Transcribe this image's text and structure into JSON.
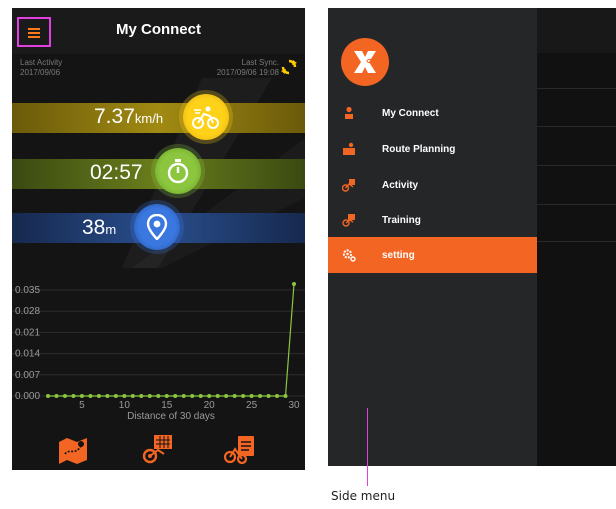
{
  "left_phone": {
    "title": "My Connect",
    "last_activity": {
      "label": "Last Activity",
      "date": "2017/09/06"
    },
    "last_sync": {
      "label": "Last Sync.",
      "datetime": "2017/09/06 19:08"
    },
    "stats": [
      {
        "value": "7.37",
        "unit": "km/h",
        "icon": "cycling-icon",
        "color": "#ffd21a"
      },
      {
        "value": "02:57",
        "unit": "",
        "icon": "stopwatch-icon",
        "color": "#8cc63f"
      },
      {
        "value": "38",
        "unit": "m",
        "icon": "location-pin-icon",
        "color": "#3a78e0"
      }
    ],
    "bottom_nav": [
      "route-map-icon",
      "bike-calendar-icon",
      "bike-clipboard-icon"
    ]
  },
  "chart_data": {
    "type": "line",
    "xlabel": "Distance of 30 days",
    "x_ticks": [
      "5",
      "10",
      "15",
      "20",
      "25",
      "30"
    ],
    "y_ticks": [
      "0.000",
      "0.007",
      "0.014",
      "0.021",
      "0.028",
      "0.035"
    ],
    "ylim": [
      0,
      0.035
    ],
    "xlim": [
      1,
      30
    ],
    "series": [
      {
        "x": [
          1,
          2,
          3,
          4,
          5,
          6,
          7,
          8,
          9,
          10,
          11,
          12,
          13,
          14,
          15,
          16,
          17,
          18,
          19,
          20,
          21,
          22,
          23,
          24,
          25,
          26,
          27,
          28,
          29,
          30
        ],
        "values": [
          0,
          0,
          0,
          0,
          0,
          0,
          0,
          0,
          0,
          0,
          0,
          0,
          0,
          0,
          0,
          0,
          0,
          0,
          0,
          0,
          0,
          0,
          0,
          0,
          0,
          0,
          0,
          0,
          0,
          0.037
        ]
      }
    ],
    "line_color": "#8cc63f",
    "grid": true
  },
  "right_phone": {
    "logo_icon": "x-logo-icon",
    "menu": [
      {
        "label": "My Connect",
        "icon": "person-icon",
        "active": false
      },
      {
        "label": "Route Planning",
        "icon": "route-icon",
        "active": false
      },
      {
        "label": "Activity",
        "icon": "bike-icon",
        "active": false
      },
      {
        "label": "Training",
        "icon": "training-icon",
        "active": false
      },
      {
        "label": "setting",
        "icon": "gear-icon",
        "active": true
      }
    ],
    "accent": "#f26522"
  },
  "callout": {
    "text": "Side menu",
    "color": "#e040e0"
  }
}
